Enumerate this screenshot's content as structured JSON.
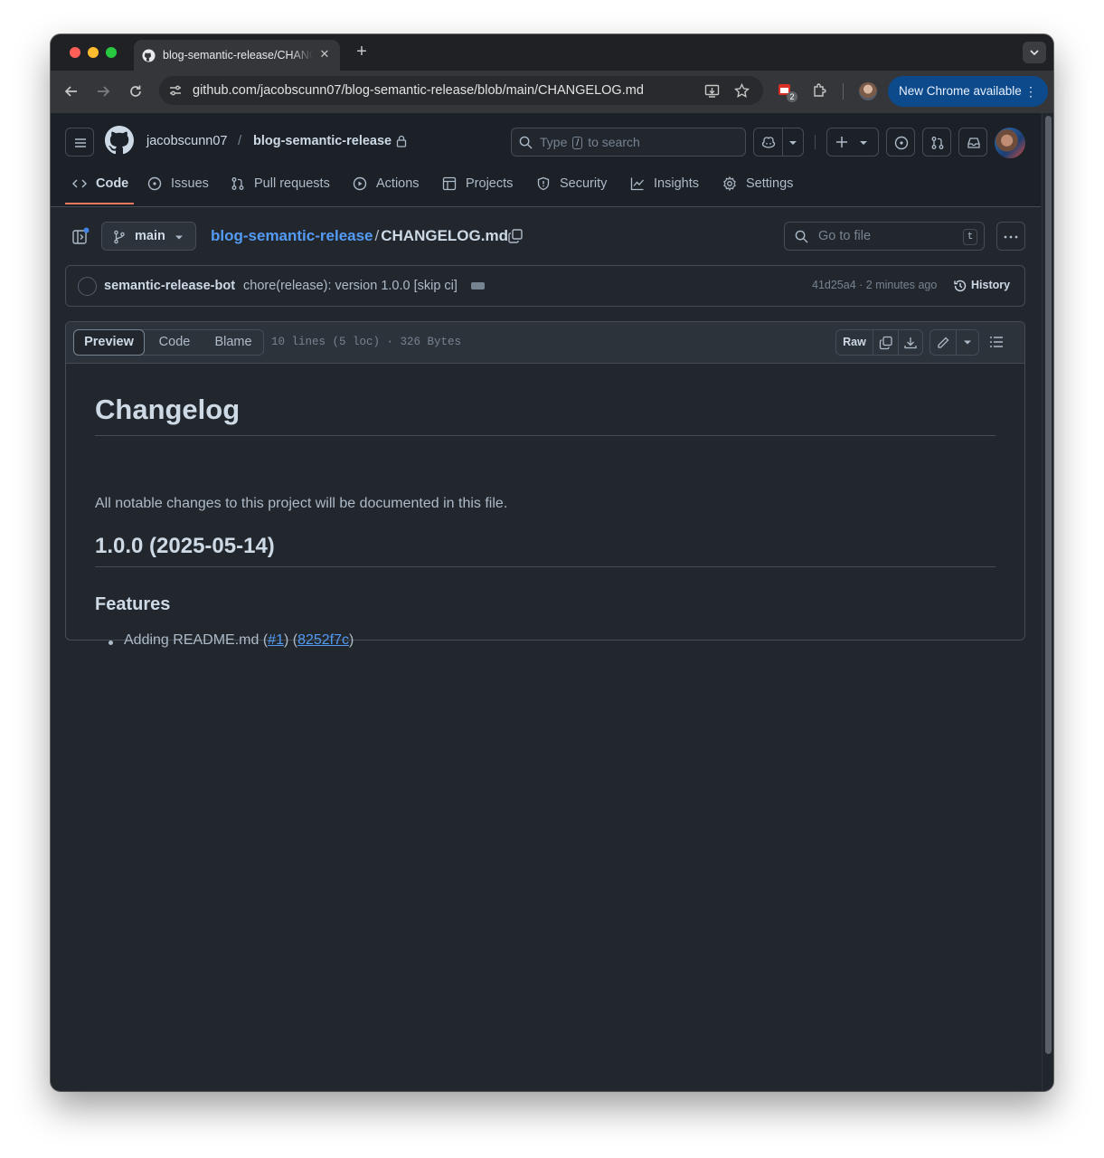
{
  "browser": {
    "tab_title": "blog-semantic-release/CHANGELOG.md",
    "url_host": "github.com",
    "url_path": "/jacobscunn07/blog-semantic-release/blob/main/CHANGELOG.md",
    "new_chrome_label": "New Chrome available",
    "extension_badge": "2"
  },
  "header": {
    "owner": "jacobscunn07",
    "separator": "/",
    "repo": "blog-semantic-release",
    "search_prefix": "Type",
    "search_key": "/",
    "search_suffix": "to search"
  },
  "nav": {
    "items": [
      {
        "label": "Code",
        "icon": "code-icon"
      },
      {
        "label": "Issues",
        "icon": "issue-opened-icon"
      },
      {
        "label": "Pull requests",
        "icon": "git-pull-request-icon"
      },
      {
        "label": "Actions",
        "icon": "play-icon"
      },
      {
        "label": "Projects",
        "icon": "table-icon"
      },
      {
        "label": "Security",
        "icon": "shield-icon"
      },
      {
        "label": "Insights",
        "icon": "graph-icon"
      },
      {
        "label": "Settings",
        "icon": "gear-icon"
      }
    ],
    "active": "Code",
    "accent_color": "#ec775c"
  },
  "file_header": {
    "branch": "main",
    "repo_link": "blog-semantic-release",
    "separator": "/",
    "filename": "CHANGELOG.md",
    "go_to_file_placeholder": "Go to file",
    "go_to_file_shortcut": "t"
  },
  "commit": {
    "author": "semantic-release-bot",
    "message": "chore(release): version 1.0.0 [skip ci]",
    "sha_time": "41d25a4 · 2 minutes ago",
    "history_label": "History"
  },
  "file_toolbar": {
    "tabs": [
      "Preview",
      "Code",
      "Blame"
    ],
    "active_tab": "Preview",
    "info": "10 lines (5 loc) · 326 Bytes",
    "raw_label": "Raw"
  },
  "markdown": {
    "h1": "Changelog",
    "intro": "All notable changes to this project will be documented in this file.",
    "h2": "1.0.0 (2025-05-14)",
    "h3": "Features",
    "item_text": "Adding README.md (",
    "item_issue": "#1",
    "item_mid": ") (",
    "item_commit": "8252f7c",
    "item_end": ")",
    "link_color": "#539bf5"
  }
}
